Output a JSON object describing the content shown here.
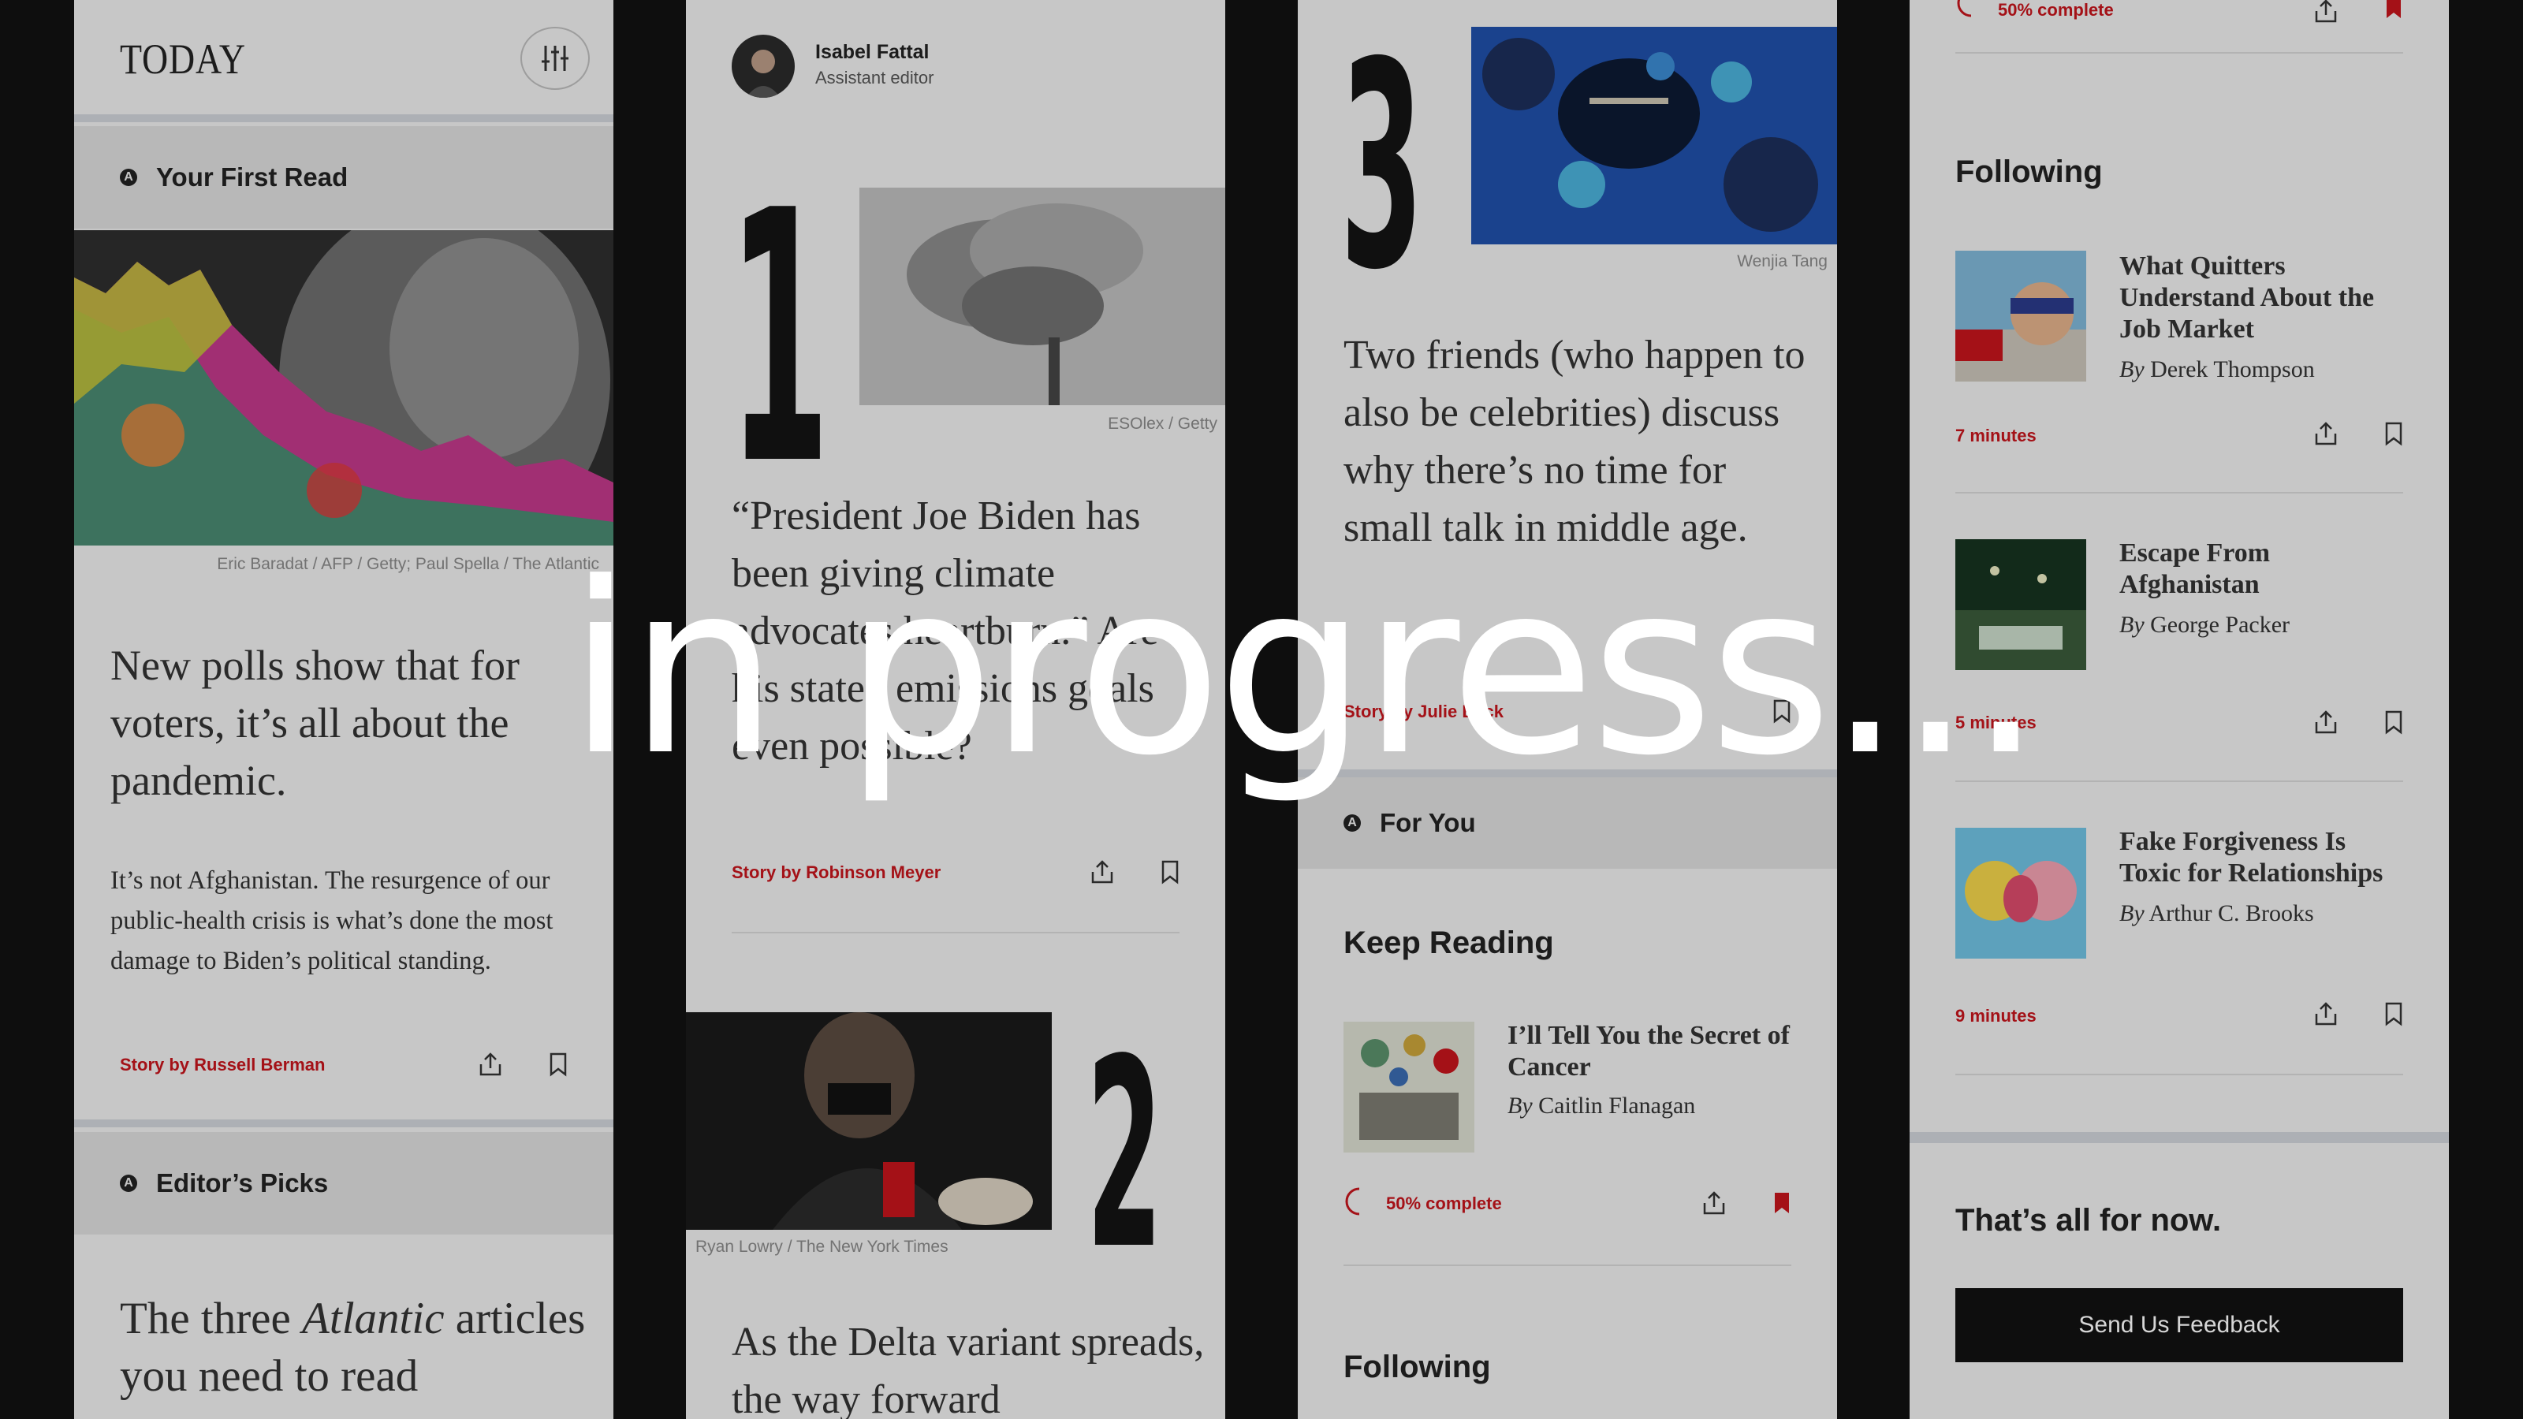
{
  "overlay_text": "in progress...",
  "col1": {
    "header_title": "TODAY",
    "first_read_label": "Your First Read",
    "hero_credit": "Eric Baradat / AFP / Getty; Paul Spella / The Atlantic",
    "headline": "New polls show that for voters, it’s all about the pandemic.",
    "dek": "It’s not Afghanistan. The resurgence of our public-health crisis is what’s done the most damage to Biden’s political standing.",
    "byline": "Story by Russell Berman",
    "editors_picks_label": "Editor’s Picks",
    "picks_headline_before": "The three ",
    "picks_headline_italic": "Atlantic",
    "picks_headline_after": " articles you need to read"
  },
  "col2": {
    "editor_name": "Isabel Fattal",
    "editor_role": "Assistant editor",
    "num1": "1",
    "img1_credit": "ESOlex / Getty",
    "quote": "“President Joe Biden has been giving climate advocates heartburn.” Are his stated emissions goals even possible?",
    "byline1": "Story by Robinson Meyer",
    "img2_credit": "Ryan Lowry / The New York Times",
    "num2": "2",
    "headline2": "As the Delta variant spreads, the way forward"
  },
  "col3": {
    "num3": "3",
    "img_credit": "Wenjia Tang",
    "headline": "Two friends (who happen to also be celebrities) discuss why there’s no time for small talk in middle age.",
    "byline": "Story by Julie Beck",
    "for_you_label": "For You",
    "keep_reading_label": "Keep Reading",
    "kr_title": "I’ll Tell You the Secret of Cancer",
    "kr_by": "By",
    "kr_author": "Caitlin Flanagan",
    "kr_progress": "50% complete",
    "following_label": "Following"
  },
  "col4": {
    "top_progress": "50% complete",
    "following_label": "Following",
    "items": [
      {
        "title": "What Quitters Understand About the Job Market",
        "by": "By",
        "author": "Derek Thompson",
        "time": "7 minutes"
      },
      {
        "title": "Escape From Afghanistan",
        "by": "By",
        "author": "George Packer",
        "time": "5 minutes"
      },
      {
        "title": "Fake Forgiveness Is Toxic for Relationships",
        "by": "By",
        "author": "Arthur C. Brooks",
        "time": "9 minutes"
      }
    ],
    "end_label": "That’s all for now.",
    "feedback_button": "Send Us Feedback"
  },
  "colors": {
    "accent_red": "#c4151c",
    "page_bg": "#111111",
    "card_bg": "#ededed",
    "section_bar": "#dcdcdc"
  },
  "icons": [
    "sliders-icon",
    "share-icon",
    "bookmark-icon",
    "bookmark-filled-icon",
    "progress-ring-icon",
    "atlantic-logo-icon"
  ]
}
